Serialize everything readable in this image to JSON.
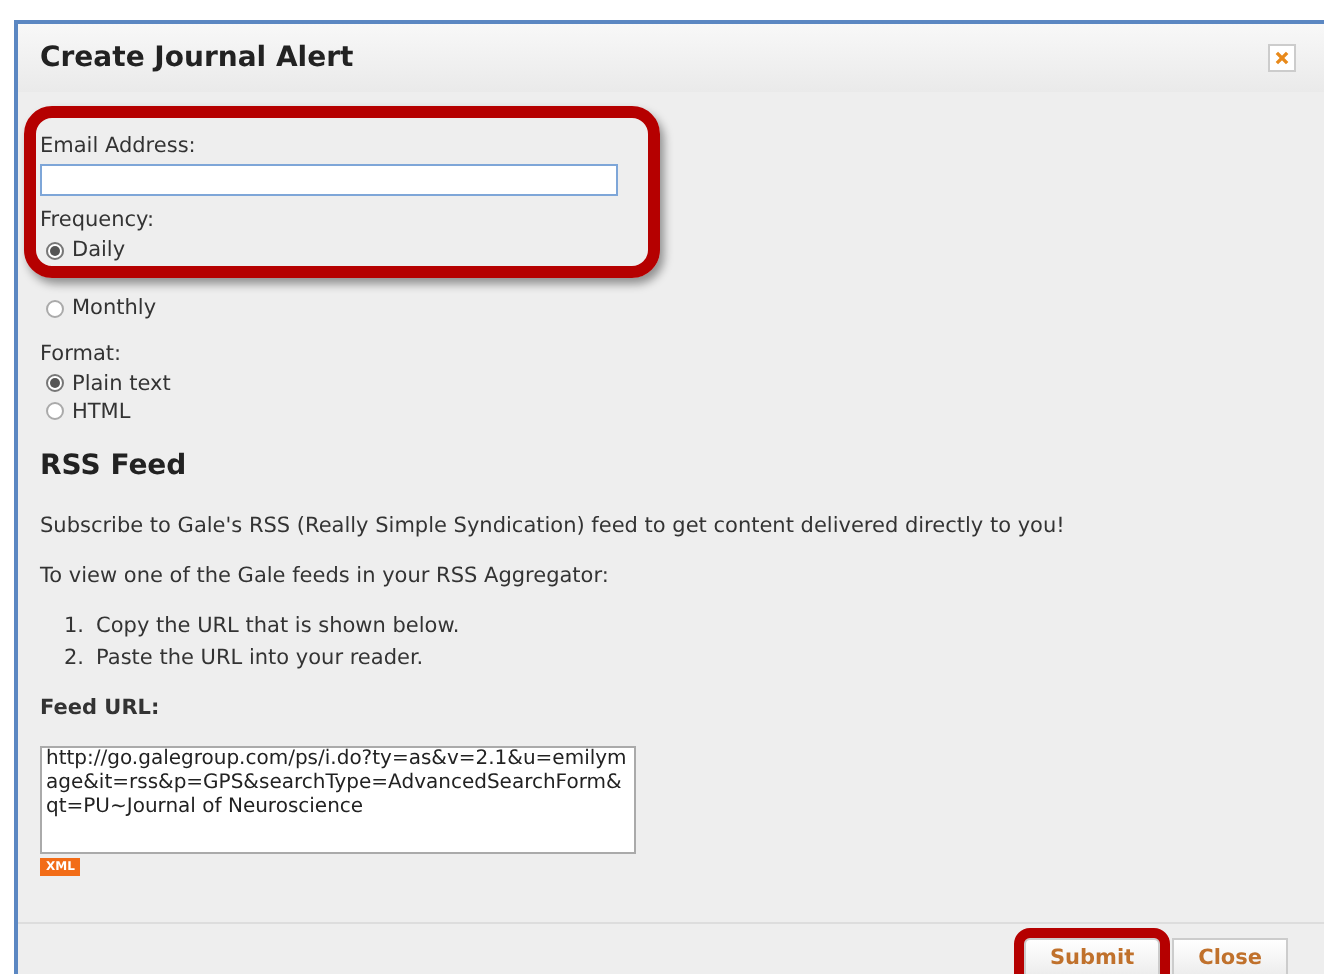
{
  "dialog": {
    "title": "Create Journal Alert"
  },
  "email": {
    "label": "Email Address:"
  },
  "frequency": {
    "label": "Frequency:",
    "options": [
      {
        "label": "Daily",
        "selected": true
      },
      {
        "label": "Monthly",
        "selected": false
      }
    ]
  },
  "format": {
    "label": "Format:",
    "options": [
      {
        "label": "Plain text",
        "selected": true
      },
      {
        "label": "HTML",
        "selected": false
      }
    ]
  },
  "rss": {
    "heading": "RSS Feed",
    "intro": "Subscribe to Gale's RSS (Really Simple Syndication) feed to get content delivered directly to you!",
    "lead": "To view one of the Gale feeds in your RSS Aggregator:",
    "steps": [
      {
        "number": "1.",
        "text": "Copy the URL that is shown below."
      },
      {
        "number": "2.",
        "text": "Paste the URL into your reader."
      }
    ],
    "feed_label": "Feed URL:",
    "feed_url": "http://go.galegroup.com/ps/i.do?ty=as&v=2.1&u=emilymage&it=rss&p=GPS&searchType=AdvancedSearchForm&qt=PU~Journal of Neuroscience",
    "badge": "XML"
  },
  "buttons": [
    {
      "label": "Submit",
      "highlighted": true
    },
    {
      "label": "Close",
      "highlighted": false
    }
  ]
}
